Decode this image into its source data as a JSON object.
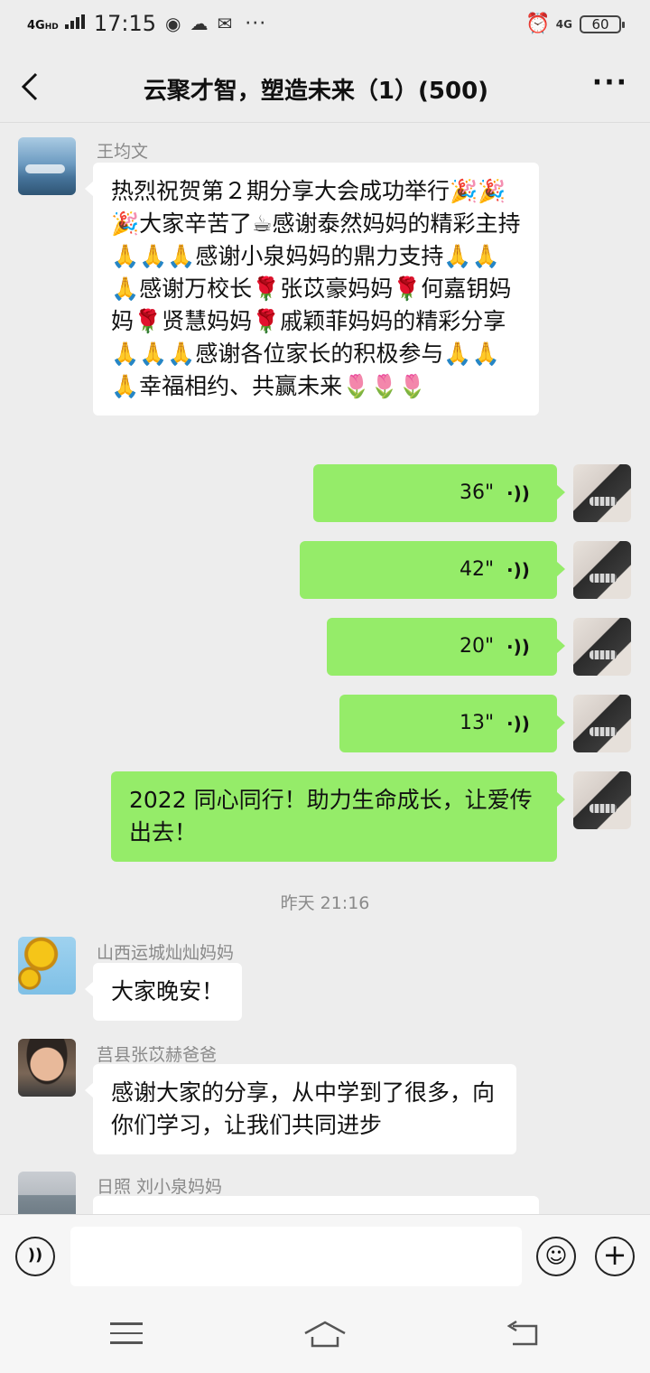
{
  "status_bar": {
    "network": "4G",
    "network_hd": "HD",
    "time": "17:15",
    "network_right": "4G",
    "battery": "60",
    "overflow": "···"
  },
  "header": {
    "title": "云聚才智，塑造未来（1）(500)",
    "more": "···"
  },
  "messages": [
    {
      "sender": "王均文",
      "text": "热烈祝贺第２期分享大会成功举行🎉🎉🎉大家辛苦了☕感谢泰然妈妈的精彩主持🙏🙏🙏感谢小泉妈妈的鼎力支持🙏🙏🙏感谢万校长🌹张苡豪妈妈🌹何嘉钥妈妈🌹贤慧妈妈🌹戚颖菲妈妈的精彩分享🙏🙏🙏感谢各位家长的积极参与🙏🙏🙏幸福相约、共赢未来🌷🌷🌷"
    },
    {
      "voice_duration": "36\""
    },
    {
      "voice_duration": "42\""
    },
    {
      "voice_duration": "20\""
    },
    {
      "voice_duration": "13\""
    },
    {
      "text": "2022 同心同行！助力生命成长，让爱传出去！"
    },
    {
      "timestamp": "昨天 21:16"
    },
    {
      "sender": "山西运城灿灿妈妈",
      "text": "大家晚安！"
    },
    {
      "sender": "莒县张苡赫爸爸",
      "text": "感谢大家的分享，从中学到了很多，向你们学习，让我们共同进步"
    },
    {
      "sender": "日照  刘小泉妈妈"
    }
  ],
  "icons": {
    "voice_wave": "((·",
    "emoji": "☺",
    "plus": "+",
    "voice_toggle": "))"
  },
  "colors": {
    "own_bubble": "#95ec69",
    "other_bubble": "#ffffff",
    "background": "#ededed"
  }
}
